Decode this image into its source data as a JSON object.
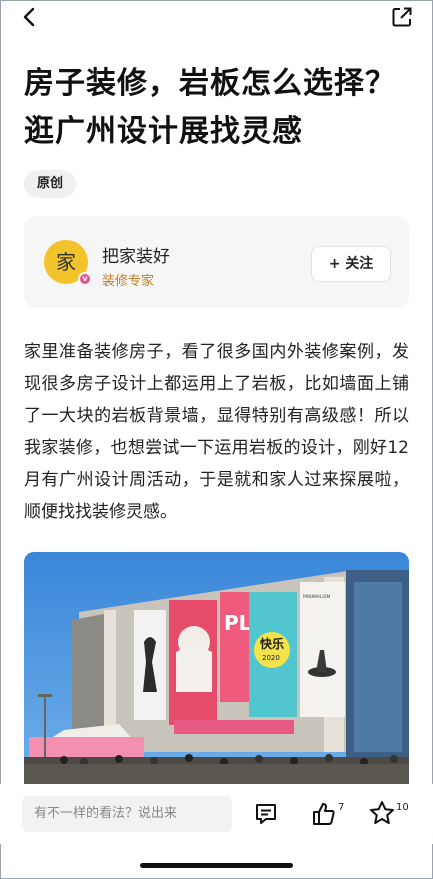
{
  "article": {
    "title": "房子装修，岩板怎么选择？逛广州设计展找灵感",
    "tag": "原创",
    "body": "家里准备装修房子，看了很多国内外装修案例，发现很多房子设计上都运用上了岩板，比如墙面上铺了一大块的岩板背景墙，显得特别有高级感！所以我家装修，也想尝试一下运用岩板的设计，刚好12月有广州设计周活动，于是就和家人过来探展啦，顺便找找装修灵感。"
  },
  "author": {
    "avatar_char": "家",
    "badge": "v",
    "name": "把家装好",
    "role": "装修专家",
    "follow_label": "+ 关注"
  },
  "photo": {
    "banner_left": "PLAY",
    "banner_mid": "快乐",
    "banner_mid_year": "2020",
    "banner_right": "MINIMALISM"
  },
  "bottom_bar": {
    "comment_placeholder": "有不一样的看法？说出来",
    "like_count": "7",
    "favorite_count": "10"
  },
  "colors": {
    "accent_gold": "#c47b2a",
    "avatar_yellow": "#f3c32b",
    "badge_pink": "#e8508b"
  }
}
